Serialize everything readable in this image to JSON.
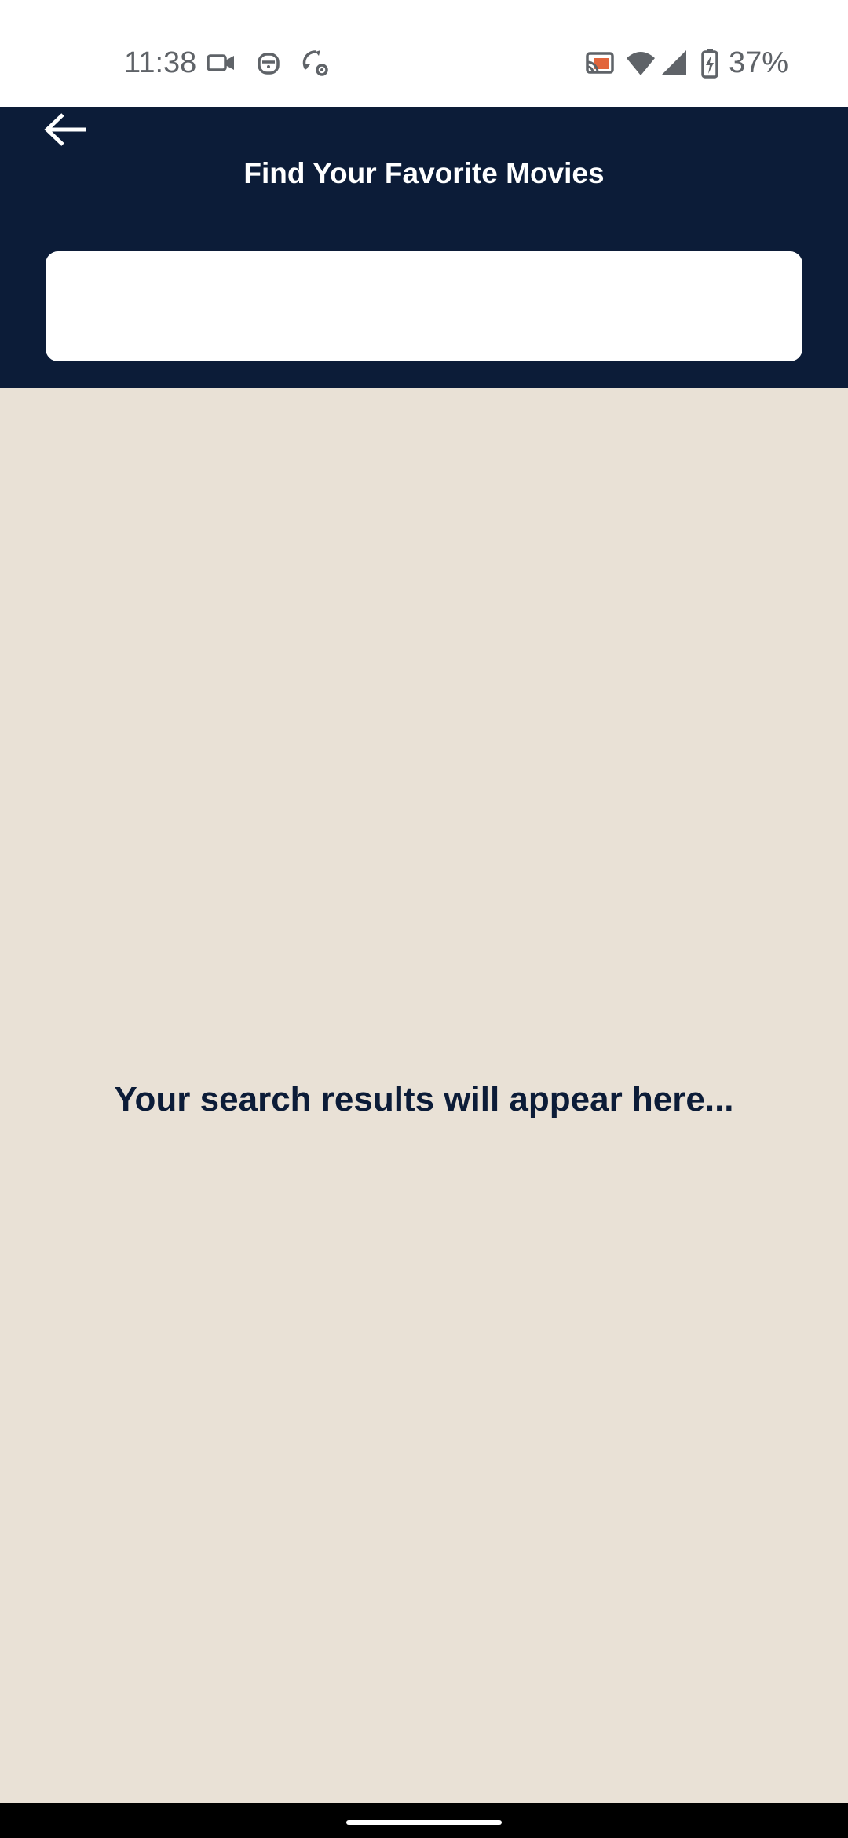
{
  "status_bar": {
    "time": "11:38",
    "battery_percent": "37%",
    "battery_level": 0.37,
    "icons": [
      "video-camera-icon",
      "robot-icon",
      "sync-settings-icon",
      "cast-icon",
      "wifi-icon",
      "cell-signal-icon",
      "battery-charging-icon"
    ],
    "cast_accent_color": "#E2653C"
  },
  "header": {
    "title": "Find Your Favorite Movies",
    "background_color": "#0C1C38",
    "back_icon": "arrow-left-icon"
  },
  "search": {
    "value": "",
    "placeholder": ""
  },
  "main": {
    "empty_state_text": "Your search results will appear here...",
    "background_color": "#E9E1D6"
  }
}
